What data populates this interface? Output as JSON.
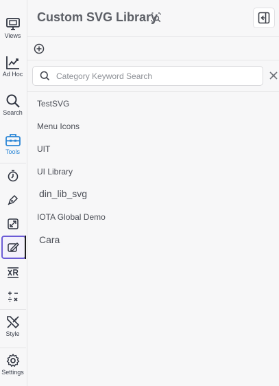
{
  "rail": {
    "views": "Views",
    "adhoc": "Ad Hoc",
    "search": "Search",
    "tools": "Tools",
    "style": "Style",
    "settings": "Settings"
  },
  "panel": {
    "title": "Custom SVG Library",
    "search_placeholder": "Category Keyword Search",
    "items": [
      "TestSVG",
      "Menu Icons",
      "UIT",
      "UI Library",
      "din_lib_svg",
      "IOTA Global Demo",
      "Cara"
    ]
  },
  "colors": {
    "accent": "#2b86d6",
    "tool_highlight": "#6b5bd6"
  }
}
